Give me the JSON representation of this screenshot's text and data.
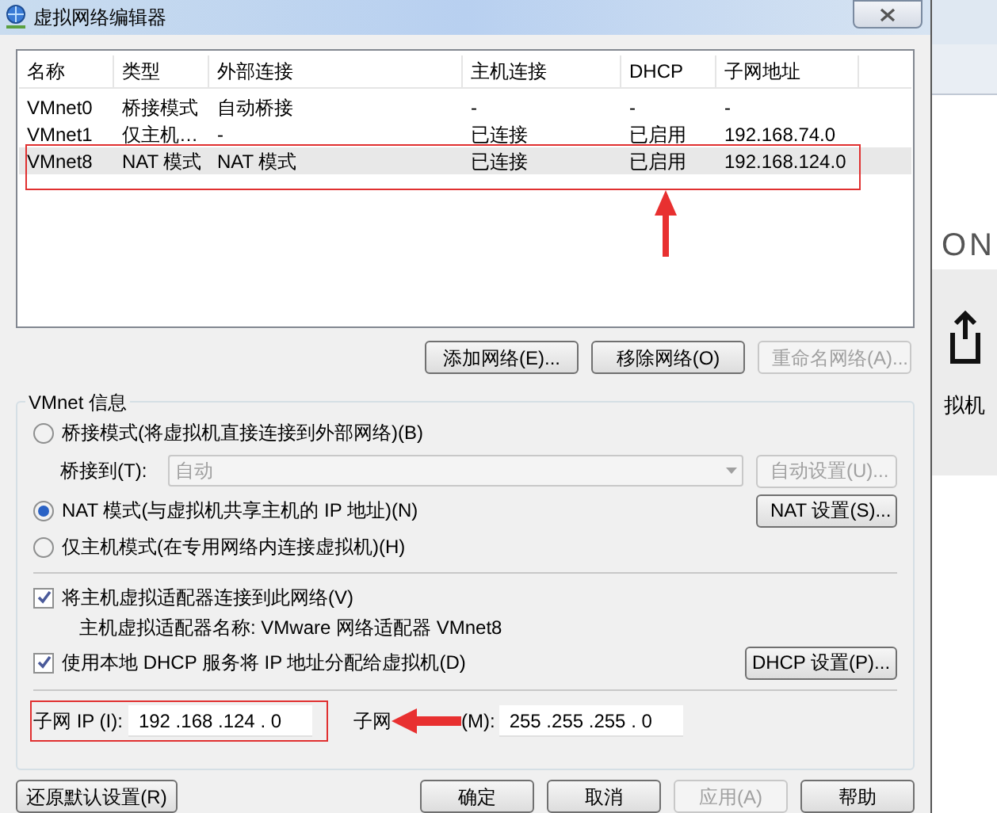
{
  "window": {
    "title": "虚拟网络编辑器"
  },
  "table": {
    "columns": [
      "名称",
      "类型",
      "外部连接",
      "主机连接",
      "DHCP",
      "子网地址"
    ],
    "rows": [
      {
        "cells": [
          "VMnet0",
          "桥接模式",
          "自动桥接",
          "-",
          "-",
          "-"
        ],
        "selected": false
      },
      {
        "cells": [
          "VMnet1",
          "仅主机…",
          "-",
          "已连接",
          "已启用",
          "192.168.74.0"
        ],
        "selected": false
      },
      {
        "cells": [
          "VMnet8",
          "NAT 模式",
          "NAT 模式",
          "已连接",
          "已启用",
          "192.168.124.0"
        ],
        "selected": true
      }
    ]
  },
  "network_buttons": [
    {
      "label": "添加网络(E)...",
      "disabled": false
    },
    {
      "label": "移除网络(O)",
      "disabled": false
    },
    {
      "label": "重命名网络(A)...",
      "disabled": true
    }
  ],
  "vmnet_info": {
    "title": "VMnet 信息",
    "bridge_radio": {
      "label": "桥接模式(将虚拟机直接连接到外部网络)(B)",
      "selected": false
    },
    "bridge_to": {
      "label": "桥接到(T):",
      "value": "自动",
      "disabled": true,
      "button": {
        "label": "自动设置(U)...",
        "disabled": true
      }
    },
    "nat_radio": {
      "label": "NAT 模式(与虚拟机共享主机的 IP 地址)(N)",
      "selected": true
    },
    "nat_button": {
      "label": "NAT 设置(S)...",
      "disabled": false
    },
    "host_only_radio": {
      "label": "仅主机模式(在专用网络内连接虚拟机)(H)",
      "selected": false
    },
    "connect_adapter": {
      "label": "将主机虚拟适配器连接到此网络(V)",
      "checked": true
    },
    "adapter_name": "主机虚拟适配器名称: VMware 网络适配器 VMnet8",
    "use_dhcp": {
      "label": "使用本地 DHCP 服务将 IP 地址分配给虚拟机(D)",
      "checked": true
    },
    "dhcp_button": {
      "label": "DHCP 设置(P)...",
      "disabled": false
    },
    "subnet_ip": {
      "label": "子网 IP (I):",
      "value": "192 .168 .124 . 0"
    },
    "subnet_mask": {
      "label_start": "子网",
      "label_end": "(M):",
      "value": "255 .255 .255 . 0"
    }
  },
  "footer_buttons": [
    {
      "label": "还原默认设置(R)",
      "disabled": false
    },
    {
      "label": "确定",
      "disabled": false
    },
    {
      "label": "取消",
      "disabled": false
    },
    {
      "label": "应用(A)",
      "disabled": true
    },
    {
      "label": "帮助",
      "disabled": false
    }
  ],
  "background_window": {
    "text_top": "ON",
    "text_bottom": "拟机"
  }
}
